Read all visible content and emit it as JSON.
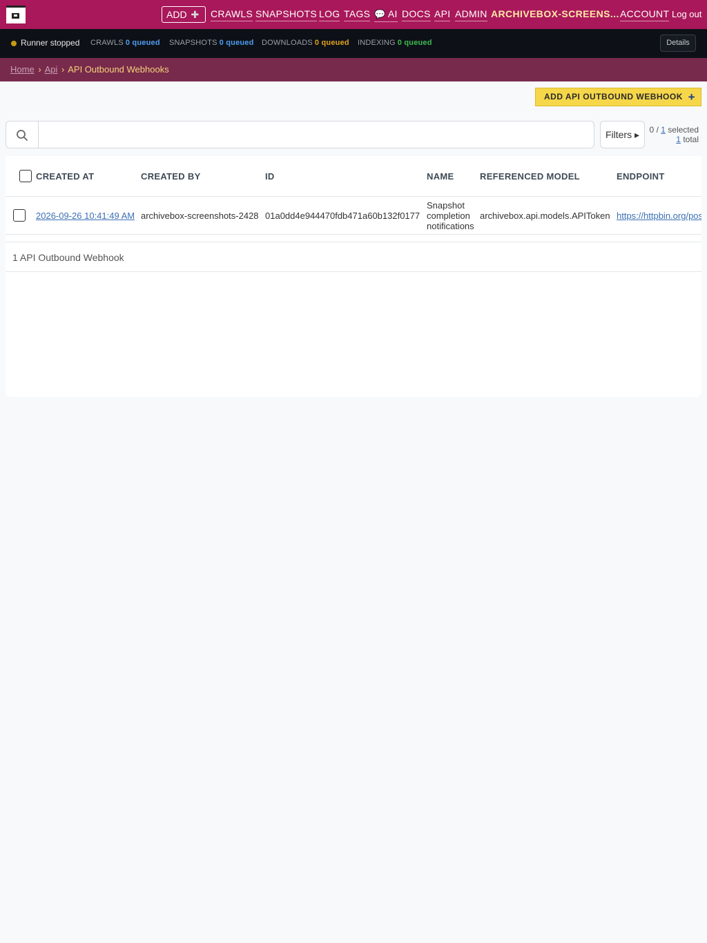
{
  "nav": {
    "logo_icon": "archivebox-logo-icon",
    "add_label": "ADD",
    "add_icon": "plus-icon",
    "items": [
      "CRAWLS",
      "SNAPSHOTS",
      "LOG",
      "TAGS",
      "AI",
      "DOCS",
      "API",
      "ADMIN"
    ],
    "ai_icon": "speech-bubble-icon",
    "user": "ARCHIVEBOX-SCREENS...",
    "account": "ACCOUNT",
    "logout": "Log out"
  },
  "status": {
    "runner": "Runner stopped",
    "runner_color": "#c99a12",
    "crawls_label": "CRAWLS",
    "crawls_queued": "0 queued",
    "snapshots_label": "SNAPSHOTS",
    "snapshots_queued": "0 queued",
    "downloads_label": "DOWNLOADS",
    "downloads_queued": "0 queued",
    "indexing_label": "INDEXING",
    "indexing_queued": "0 queued",
    "queued_colors": {
      "crawls": "#4f9df0",
      "snapshots": "#4f9df0",
      "downloads": "#e0a21e",
      "indexing": "#3fb950"
    },
    "details": "Details"
  },
  "breadcrumbs": {
    "home": "Home",
    "api": "Api",
    "sep": "›",
    "current": "API Outbound Webhooks"
  },
  "actions": {
    "add_webhook": "ADD API OUTBOUND WEBHOOK",
    "add_icon": "plus-icon"
  },
  "search": {
    "icon": "search-icon",
    "value": "",
    "filters": "Filters ▸"
  },
  "selection": {
    "selected_count": "0",
    "of": "/",
    "total_link": "1",
    "selected_word": "selected",
    "total_count": "1",
    "total_word": "total"
  },
  "table": {
    "columns": [
      "CREATED AT",
      "CREATED BY",
      "ID",
      "NAME",
      "REFERENCED MODEL",
      "ENDPOINT"
    ],
    "rows": [
      {
        "created_at": "2026-09-26 10:41:49 AM",
        "created_by": "archivebox-screenshots-2428",
        "id": "01a0dd4e944470fdb471a60b132f0177",
        "name_lines": [
          "Snapshot",
          "completion",
          "notifications"
        ],
        "referenced_model": "archivebox.api.models.APIToken",
        "endpoint": "https://httpbin.org/post"
      }
    ],
    "footer": "1 API Outbound Webhook"
  }
}
